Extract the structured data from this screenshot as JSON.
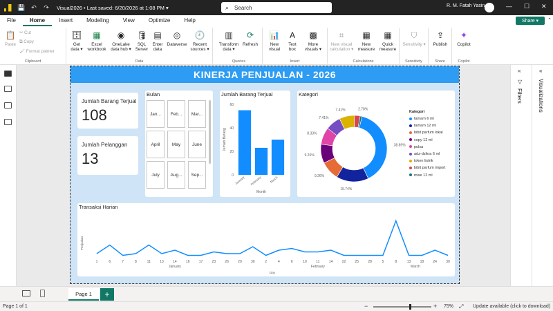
{
  "titlebar": {
    "title": "Visual2026 • Last saved: 6/20/2026 at 1:08 PM ▾",
    "search_placeholder": "Search",
    "user": "R. M. Fatah Yasin",
    "undo_glyph": "↶",
    "redo_glyph": "↷",
    "save_glyph": "💾",
    "min_glyph": "—",
    "max_glyph": "☐",
    "close_glyph": "✕"
  },
  "menu": {
    "items": [
      "File",
      "Home",
      "Insert",
      "Modeling",
      "View",
      "Optimize",
      "Help"
    ],
    "active": "Home",
    "share": "Share ▾"
  },
  "ribbon": {
    "clipboard": {
      "label": "Clipboard",
      "paste": "Paste",
      "cut": "Cut",
      "copy": "Copy",
      "format_painter": "Format painter"
    },
    "data": {
      "label": "Data",
      "get_data": "Get data ▾",
      "excel": "Excel workbook",
      "onelake": "OneLake data hub ▾",
      "sql": "SQL Server",
      "enter": "Enter data",
      "dataverse": "Dataverse",
      "recent": "Recent sources ▾"
    },
    "queries": {
      "label": "Queries",
      "transform": "Transform data ▾",
      "refresh": "Refresh"
    },
    "insert": {
      "label": "Insert",
      "new_visual": "New visual",
      "text_box": "Text box",
      "more_visuals": "More visuals ▾"
    },
    "calculations": {
      "label": "Calculations",
      "new_visual_calc": "New visual calculation ▾",
      "new_measure": "New measure",
      "quick_measure": "Quick measure"
    },
    "sensitivity": {
      "label": "Sensitivity",
      "sensitivity": "Sensitivity ▾"
    },
    "share": {
      "label": "Share",
      "publish": "Publish"
    },
    "copilot": {
      "label": "Copilot",
      "copilot": "Copilot"
    }
  },
  "report": {
    "banner": "KINERJA PENJUALAN - 2026",
    "kpi1": {
      "label": "Jumlah Barang Terjual",
      "value": "108"
    },
    "kpi2": {
      "label": "Jumlah Pelanggan",
      "value": "13"
    },
    "slicer": {
      "title": "Bulan",
      "items": [
        "Jan...",
        "Feb...",
        "Mar...",
        "April",
        "May",
        "June",
        "July",
        "Aug...",
        "Sep..."
      ]
    },
    "bar_title": "Jumlah Barang Terjual",
    "donut_title": "Kategori",
    "line_title": "Transaksi Harian"
  },
  "panes": {
    "filters": "Filters",
    "visualizations": "Visualizations",
    "filter_glyph": "▽",
    "chevron": "«"
  },
  "pagebar": {
    "page1": "Page 1",
    "add": "+"
  },
  "status": {
    "page": "Page 1 of 1",
    "zoom": "75%",
    "update": "Update available (click to download)",
    "minus": "−",
    "plus": "+"
  },
  "colors": {
    "accent": "#117865",
    "banner": "#2d9cf2",
    "canvas_bg": "#cfe4f6",
    "bar": "#118dff"
  },
  "chart_data": [
    {
      "type": "bar",
      "title": "Jumlah Barang Terjual",
      "categories": [
        "January",
        "February",
        "March"
      ],
      "values": [
        55,
        23,
        30
      ],
      "xlabel": "Month",
      "ylabel": "Jumlah Barang",
      "ylim": [
        0,
        60
      ],
      "yticks": [
        0,
        20,
        40,
        60
      ],
      "color": "#118dff"
    },
    {
      "type": "pie",
      "title": "Kategori",
      "donut": true,
      "categories": [
        "tamam 6 ml",
        "tamam 12 ml",
        "bibit parfum lokal",
        "copy 12 ml",
        "pulsa",
        "adz-dzikra 6 ml",
        "token listrik",
        "bibit parfum import",
        "mise 12 ml"
      ],
      "values": [
        38.89,
        15.74,
        9.26,
        9.26,
        8.33,
        7.41,
        7.41,
        2.78,
        0.92
      ],
      "labels": [
        "38.89%",
        "15.74%",
        "9.26%",
        "9.26%",
        "8.33%",
        "7.41%",
        "7.41%",
        "2.78%",
        ""
      ],
      "colors": [
        "#118dff",
        "#12239e",
        "#e66c37",
        "#6b007b",
        "#e044a7",
        "#744ec2",
        "#d9b300",
        "#d64550",
        "#197278"
      ],
      "legend": "right"
    },
    {
      "type": "line",
      "title": "Transaksi Harian",
      "xlabel": "Day",
      "ylabel": "Penjualan",
      "x_ticks": [
        "1",
        "6",
        "7",
        "8",
        "11",
        "13",
        "14",
        "16",
        "17",
        "23",
        "26",
        "29",
        "30",
        "2",
        "4",
        "6",
        "10",
        "11",
        "14",
        "22",
        "25",
        "28",
        "5",
        "8",
        "13",
        "18",
        "24",
        "30"
      ],
      "x_groups": [
        {
          "label": "January",
          "from": 0,
          "to": 12
        },
        {
          "label": "February",
          "from": 13,
          "to": 21
        },
        {
          "label": "March",
          "from": 22,
          "to": 27
        }
      ],
      "values": [
        2,
        7,
        1,
        2,
        7,
        2,
        4,
        1,
        1,
        3,
        2,
        2,
        6,
        1,
        4,
        5,
        3,
        3,
        4,
        1,
        1,
        1,
        1,
        21,
        1,
        1,
        4,
        1
      ],
      "ylim": [
        0,
        24
      ],
      "color": "#118dff"
    }
  ]
}
